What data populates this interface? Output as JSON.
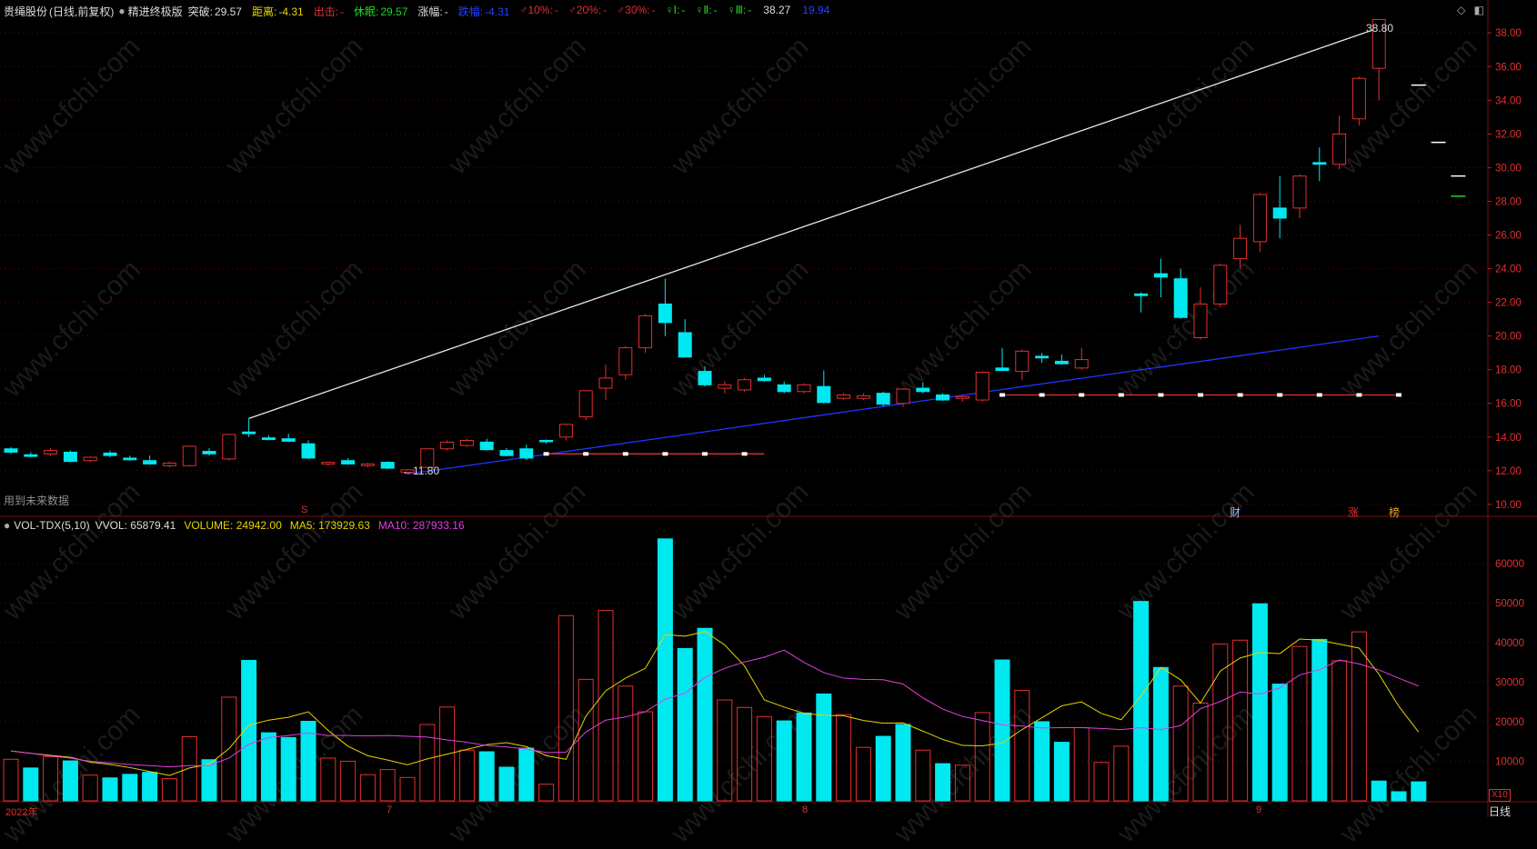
{
  "stock": {
    "name": "贵绳股份",
    "period": "(日线,前复权)",
    "indicator": "精进终极版",
    "fields": [
      {
        "label": "突破:",
        "value": "29.57",
        "lc": "#dddddd",
        "vc": "#dddddd"
      },
      {
        "label": "距离:",
        "value": "-4.31",
        "lc": "#e8d400",
        "vc": "#e8d400"
      },
      {
        "label": "出击:",
        "value": "-",
        "lc": "#e23030",
        "vc": "#e23030"
      },
      {
        "label": "休眠:",
        "value": "29.57",
        "lc": "#22d522",
        "vc": "#22d522"
      },
      {
        "label": "涨幅:",
        "value": "-",
        "lc": "#dddddd",
        "vc": "#dddddd"
      },
      {
        "label": "跌幅:",
        "value": "-4.31",
        "lc": "#2740ff",
        "vc": "#2740ff"
      },
      {
        "label": "♂10%:",
        "value": "-",
        "lc": "#e23030",
        "vc": "#e23030"
      },
      {
        "label": "♂20%:",
        "value": "-",
        "lc": "#e23030",
        "vc": "#e23030"
      },
      {
        "label": "♂30%:",
        "value": "-",
        "lc": "#e23030",
        "vc": "#e23030"
      },
      {
        "label": "♀Ⅰ:",
        "value": "-",
        "lc": "#22d522",
        "vc": "#22d522"
      },
      {
        "label": "♀Ⅱ:",
        "value": "-",
        "lc": "#22d522",
        "vc": "#22d522"
      },
      {
        "label": "♀Ⅲ:",
        "value": "-",
        "lc": "#22d522",
        "vc": "#22d522"
      },
      {
        "label": "",
        "value": "38.27",
        "lc": "#dddddd",
        "vc": "#dddddd"
      },
      {
        "label": "",
        "value": "19.94",
        "lc": "#2740ff",
        "vc": "#2740ff"
      }
    ]
  },
  "vol_header": {
    "name": "VOL-TDX(5,10)",
    "fields": [
      {
        "label": "VVOL:",
        "value": "65879.41",
        "c": "#dddddd"
      },
      {
        "label": "VOLUME:",
        "value": "24942.00",
        "c": "#e8d400"
      },
      {
        "label": "MA5:",
        "value": "173929.63",
        "c": "#e8d400"
      },
      {
        "label": "MA10:",
        "value": "287933.16",
        "c": "#e040e0"
      }
    ]
  },
  "price_axis": [
    "38.00",
    "36.00",
    "34.00",
    "32.00",
    "30.00",
    "28.00",
    "26.00",
    "24.00",
    "22.00",
    "20.00",
    "18.00",
    "16.00",
    "14.00",
    "12.00",
    "10.00"
  ],
  "vol_axis": [
    "60000",
    "50000",
    "40000",
    "30000",
    "20000",
    "10000"
  ],
  "annotations": {
    "high": "38.80",
    "low": "←11.80",
    "future_note": "用到未来数据",
    "marker_s": "S",
    "tag_cai": "财",
    "tag_zhang": "涨",
    "tag_bang": "榜",
    "x10": "X10",
    "period_tab": "日线"
  },
  "x_axis": [
    "2022年",
    "7",
    "8",
    "9"
  ],
  "watermark": "www.cfchi.com",
  "colors": {
    "up": "#e23030",
    "down": "#00e8f0",
    "bg": "#000000"
  },
  "chart_data": [
    {
      "type": "candlestick",
      "title": "贵绳股份 (日线,前复权)",
      "ylim": [
        9.4,
        39.2
      ],
      "candles": [
        {
          "o": 13.3,
          "h": 13.4,
          "l": 13.0,
          "c": 13.1
        },
        {
          "o": 12.95,
          "h": 13.1,
          "l": 12.8,
          "c": 12.85
        },
        {
          "o": 13.0,
          "h": 13.35,
          "l": 12.9,
          "c": 13.2
        },
        {
          "o": 13.1,
          "h": 13.2,
          "l": 12.5,
          "c": 12.55
        },
        {
          "o": 12.6,
          "h": 12.85,
          "l": 12.5,
          "c": 12.8
        },
        {
          "o": 13.05,
          "h": 13.2,
          "l": 12.8,
          "c": 12.9
        },
        {
          "o": 12.75,
          "h": 12.9,
          "l": 12.6,
          "c": 12.65
        },
        {
          "o": 12.6,
          "h": 12.9,
          "l": 12.35,
          "c": 12.4
        },
        {
          "o": 12.3,
          "h": 12.55,
          "l": 12.2,
          "c": 12.45
        },
        {
          "o": 12.3,
          "h": 13.5,
          "l": 12.25,
          "c": 13.45
        },
        {
          "o": 13.15,
          "h": 13.35,
          "l": 12.9,
          "c": 13.0
        },
        {
          "o": 12.7,
          "h": 14.2,
          "l": 12.6,
          "c": 14.15
        },
        {
          "o": 14.3,
          "h": 15.1,
          "l": 14.0,
          "c": 14.2
        },
        {
          "o": 13.95,
          "h": 14.1,
          "l": 13.8,
          "c": 13.85
        },
        {
          "o": 13.9,
          "h": 14.2,
          "l": 13.7,
          "c": 13.75
        },
        {
          "o": 13.6,
          "h": 13.8,
          "l": 12.7,
          "c": 12.75
        },
        {
          "o": 12.4,
          "h": 12.55,
          "l": 12.3,
          "c": 12.5
        },
        {
          "o": 12.6,
          "h": 12.75,
          "l": 12.35,
          "c": 12.4
        },
        {
          "o": 12.3,
          "h": 12.45,
          "l": 12.2,
          "c": 12.4
        },
        {
          "o": 12.5,
          "h": 12.55,
          "l": 12.1,
          "c": 12.15
        },
        {
          "o": 11.9,
          "h": 12.1,
          "l": 11.8,
          "c": 12.05
        },
        {
          "o": 12.2,
          "h": 13.35,
          "l": 12.15,
          "c": 13.3
        },
        {
          "o": 13.3,
          "h": 13.8,
          "l": 13.2,
          "c": 13.7
        },
        {
          "o": 13.5,
          "h": 13.9,
          "l": 13.4,
          "c": 13.8
        },
        {
          "o": 13.7,
          "h": 13.9,
          "l": 13.2,
          "c": 13.25
        },
        {
          "o": 13.2,
          "h": 13.35,
          "l": 12.85,
          "c": 12.9
        },
        {
          "o": 13.3,
          "h": 13.55,
          "l": 12.65,
          "c": 12.75
        },
        {
          "o": 13.8,
          "h": 13.85,
          "l": 13.6,
          "c": 13.75
        },
        {
          "o": 14.0,
          "h": 14.8,
          "l": 13.8,
          "c": 14.75
        },
        {
          "o": 15.2,
          "h": 16.8,
          "l": 15.0,
          "c": 16.75
        },
        {
          "o": 16.9,
          "h": 18.3,
          "l": 16.2,
          "c": 17.5
        },
        {
          "o": 17.7,
          "h": 19.4,
          "l": 17.4,
          "c": 19.3
        },
        {
          "o": 19.3,
          "h": 21.3,
          "l": 19.0,
          "c": 21.2
        },
        {
          "o": 21.9,
          "h": 23.4,
          "l": 20.0,
          "c": 20.8
        },
        {
          "o": 20.2,
          "h": 21.0,
          "l": 18.8,
          "c": 18.75
        },
        {
          "o": 17.9,
          "h": 18.2,
          "l": 17.0,
          "c": 17.1
        },
        {
          "o": 16.9,
          "h": 17.3,
          "l": 16.6,
          "c": 17.1
        },
        {
          "o": 16.8,
          "h": 17.5,
          "l": 16.7,
          "c": 17.4
        },
        {
          "o": 17.5,
          "h": 17.7,
          "l": 17.3,
          "c": 17.35
        },
        {
          "o": 17.1,
          "h": 17.3,
          "l": 16.6,
          "c": 16.7
        },
        {
          "o": 16.7,
          "h": 17.2,
          "l": 16.6,
          "c": 17.1
        },
        {
          "o": 17.0,
          "h": 17.95,
          "l": 16.0,
          "c": 16.05
        },
        {
          "o": 16.3,
          "h": 16.6,
          "l": 16.2,
          "c": 16.5
        },
        {
          "o": 16.3,
          "h": 16.6,
          "l": 16.2,
          "c": 16.45
        },
        {
          "o": 16.6,
          "h": 16.7,
          "l": 15.8,
          "c": 15.95
        },
        {
          "o": 16.0,
          "h": 16.9,
          "l": 15.8,
          "c": 16.85
        },
        {
          "o": 16.9,
          "h": 17.25,
          "l": 16.6,
          "c": 16.7
        },
        {
          "o": 16.5,
          "h": 16.6,
          "l": 16.15,
          "c": 16.2
        },
        {
          "o": 16.3,
          "h": 16.45,
          "l": 16.1,
          "c": 16.4
        },
        {
          "o": 16.2,
          "h": 17.9,
          "l": 16.1,
          "c": 17.85
        },
        {
          "o": 18.1,
          "h": 19.3,
          "l": 17.9,
          "c": 17.95
        },
        {
          "o": 17.9,
          "h": 19.2,
          "l": 17.4,
          "c": 19.1
        },
        {
          "o": 18.8,
          "h": 19.0,
          "l": 18.4,
          "c": 18.7
        },
        {
          "o": 18.5,
          "h": 18.9,
          "l": 18.3,
          "c": 18.35
        },
        {
          "o": 18.1,
          "h": 19.3,
          "l": 18.0,
          "c": 18.6
        },
        {
          "o": null,
          "h": null,
          "l": null,
          "c": null
        },
        {
          "o": null,
          "h": null,
          "l": null,
          "c": null
        },
        {
          "o": 22.5,
          "h": 22.6,
          "l": 21.4,
          "c": 22.4
        },
        {
          "o": 23.7,
          "h": 24.6,
          "l": 22.3,
          "c": 23.5
        },
        {
          "o": 23.4,
          "h": 24.0,
          "l": 21.0,
          "c": 21.1
        },
        {
          "o": 19.9,
          "h": 22.9,
          "l": 19.8,
          "c": 21.9
        },
        {
          "o": 21.9,
          "h": 24.3,
          "l": 21.7,
          "c": 24.2
        },
        {
          "o": 24.6,
          "h": 26.6,
          "l": 24.0,
          "c": 25.8
        },
        {
          "o": 25.6,
          "h": 28.5,
          "l": 25.0,
          "c": 28.4
        },
        {
          "o": 27.6,
          "h": 29.5,
          "l": 25.8,
          "c": 27.0
        },
        {
          "o": 27.6,
          "h": 29.6,
          "l": 27.0,
          "c": 29.5
        },
        {
          "o": 30.3,
          "h": 31.2,
          "l": 29.2,
          "c": 30.2
        },
        {
          "o": 30.2,
          "h": 33.1,
          "l": 29.9,
          "c": 32.0
        },
        {
          "o": 32.9,
          "h": 35.4,
          "l": 32.5,
          "c": 35.3
        },
        {
          "o": 35.9,
          "h": 38.8,
          "l": 34.0,
          "c": 38.8
        }
      ],
      "upper_line": [
        [
          12,
          15.1
        ],
        [
          69,
          38.3
        ]
      ],
      "lower_line": [
        [
          20,
          11.8
        ],
        [
          69,
          20.0
        ]
      ],
      "support_lines": [
        {
          "y": 13.0,
          "x": [
            27,
            38
          ]
        },
        {
          "y": 16.5,
          "x": [
            50,
            70
          ]
        }
      ],
      "future_ticks": [
        {
          "x": 71,
          "y": 34.9,
          "c": "#ffffff"
        },
        {
          "x": 72,
          "y": 31.5,
          "c": "#ffffff"
        },
        {
          "x": 73,
          "y": 29.5,
          "c": "#ffffff"
        },
        {
          "x": 73,
          "y": 28.3,
          "c": "#22d522"
        }
      ]
    },
    {
      "type": "bar",
      "title": "VOL-TDX(5,10)",
      "ylim": [
        0,
        68000
      ],
      "values": [
        10500,
        8300,
        11200,
        10100,
        6500,
        5800,
        6700,
        7200,
        5600,
        16200,
        10400,
        26200,
        35500,
        17200,
        16000,
        20100,
        10800,
        10000,
        6600,
        7900,
        5900,
        19300,
        23700,
        12800,
        12400,
        8500,
        13300,
        4200,
        46800,
        30700,
        48100,
        29000,
        22500,
        66200,
        38500,
        43600,
        25500,
        23600,
        21300,
        20200,
        22200,
        27000,
        21800,
        13500,
        16300,
        19300,
        12800,
        9400,
        9000,
        22300,
        35600,
        27900,
        20000,
        14800,
        18500,
        9700,
        13800,
        50400,
        33700,
        29000,
        24700,
        39600,
        40600,
        49800,
        29500,
        39000,
        40800,
        35400,
        42700,
        5000,
        2300,
        4800
      ],
      "up": [
        1,
        0,
        1,
        0,
        1,
        0,
        0,
        0,
        1,
        1,
        0,
        1,
        0,
        0,
        0,
        0,
        1,
        1,
        1,
        1,
        1,
        1,
        1,
        1,
        0,
        0,
        0,
        1,
        1,
        1,
        1,
        1,
        1,
        0,
        0,
        0,
        1,
        1,
        1,
        0,
        0,
        0,
        1,
        1,
        0,
        0,
        1,
        0,
        1,
        1,
        0,
        1,
        0,
        0,
        1,
        1,
        1,
        0,
        0,
        1,
        1,
        1,
        1,
        0,
        0,
        1,
        0,
        1,
        1,
        0,
        0,
        0
      ],
      "ma5": [
        12600,
        12000,
        11500,
        11000,
        9800,
        9200,
        8400,
        7400,
        6400,
        8300,
        9200,
        13200,
        19100,
        20400,
        21100,
        22500,
        17800,
        13800,
        11400,
        10300,
        9100,
        10600,
        11800,
        13000,
        14200,
        14700,
        13700,
        11400,
        10500,
        21400,
        27800,
        31000,
        33500,
        42000,
        41600,
        42800,
        39400,
        34100,
        25500,
        23700,
        22100,
        21600,
        21500,
        20300,
        19600,
        19700,
        17600,
        15500,
        14000,
        13900,
        14600,
        18000,
        21000,
        24000,
        25000,
        22100,
        20500,
        26500,
        33700,
        30600,
        24700,
        32800,
        36100,
        37500,
        37200,
        40900,
        40600,
        39600,
        38600,
        32000,
        23900,
        17400
      ],
      "ma10": [
        12600,
        12000,
        11300,
        10800,
        10000,
        9600,
        9200,
        8900,
        8600,
        8900,
        8900,
        10800,
        14300,
        16000,
        16500,
        17100,
        16500,
        16500,
        16400,
        16500,
        16300,
        16100,
        15400,
        14800,
        14000,
        13600,
        13100,
        12200,
        12300,
        17400,
        20400,
        21200,
        22500,
        25700,
        27200,
        31200,
        33500,
        35100,
        36300,
        38100,
        35000,
        32400,
        31000,
        30700,
        30600,
        29500,
        26000,
        23200,
        21300,
        20300,
        19200,
        18900,
        18400,
        18500,
        18500,
        18300,
        18000,
        18500,
        18000,
        19000,
        23300,
        25100,
        27500,
        27000,
        28500,
        31800,
        33100,
        35600,
        34600,
        33100,
        31000,
        29000
      ]
    }
  ]
}
